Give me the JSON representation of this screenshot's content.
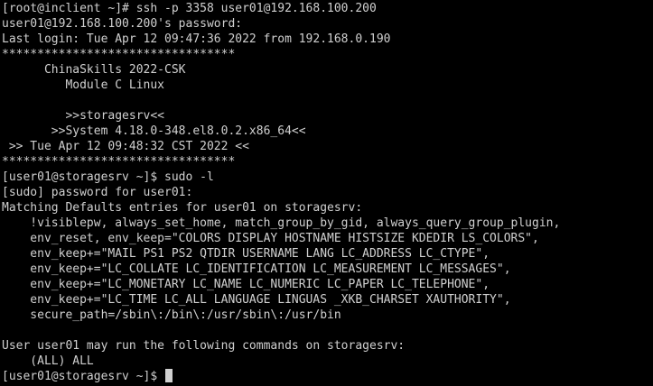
{
  "colors": {
    "background": "#000000",
    "foreground": "#d0d0d0"
  },
  "terminal": {
    "lines": [
      "[root@inclient ~]# ssh -p 3358 user01@192.168.100.200",
      "user01@192.168.100.200's password:",
      "Last login: Tue Apr 12 09:47:36 2022 from 192.168.0.190",
      "*********************************",
      "      ChinaSkills 2022-CSK",
      "         Module C Linux",
      "",
      "         >>storagesrv<<",
      "       >>System 4.18.0-348.el8.0.2.x86_64<<",
      " >> Tue Apr 12 09:48:32 CST 2022 <<",
      "*********************************",
      "[user01@storagesrv ~]$ sudo -l",
      "[sudo] password for user01:",
      "Matching Defaults entries for user01 on storagesrv:",
      "    !visiblepw, always_set_home, match_group_by_gid, always_query_group_plugin,",
      "    env_reset, env_keep=\"COLORS DISPLAY HOSTNAME HISTSIZE KDEDIR LS_COLORS\",",
      "    env_keep+=\"MAIL PS1 PS2 QTDIR USERNAME LANG LC_ADDRESS LC_CTYPE\",",
      "    env_keep+=\"LC_COLLATE LC_IDENTIFICATION LC_MEASUREMENT LC_MESSAGES\",",
      "    env_keep+=\"LC_MONETARY LC_NAME LC_NUMERIC LC_PAPER LC_TELEPHONE\",",
      "    env_keep+=\"LC_TIME LC_ALL LANGUAGE LINGUAS _XKB_CHARSET XAUTHORITY\",",
      "    secure_path=/sbin\\:/bin\\:/usr/sbin\\:/usr/bin",
      "",
      "User user01 may run the following commands on storagesrv:",
      "    (ALL) ALL"
    ],
    "prompt": "[user01@storagesrv ~]$ "
  }
}
